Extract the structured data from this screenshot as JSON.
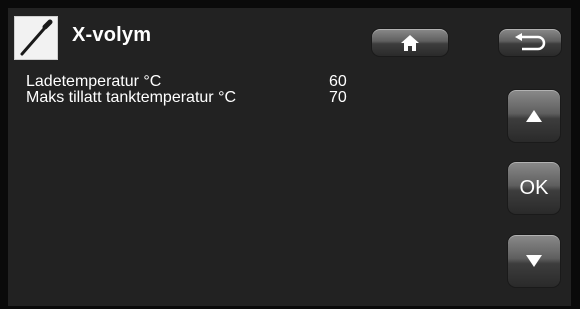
{
  "header": {
    "title": "X-volym",
    "icon": "thermometer-probe-icon"
  },
  "nav": {
    "home_icon": "home-icon",
    "back_icon": "back-arrow-icon"
  },
  "side_buttons": {
    "up_icon": "triangle-up-icon",
    "ok_label": "OK",
    "down_icon": "triangle-down-icon"
  },
  "settings": [
    {
      "label": "Ladetemperatur °C",
      "value": "60"
    },
    {
      "label": "Maks tillatt tanktemperatur °C",
      "value": "70"
    }
  ],
  "colors": {
    "background": "#222222",
    "text": "#ffffff",
    "button": "#5f5f5f"
  }
}
